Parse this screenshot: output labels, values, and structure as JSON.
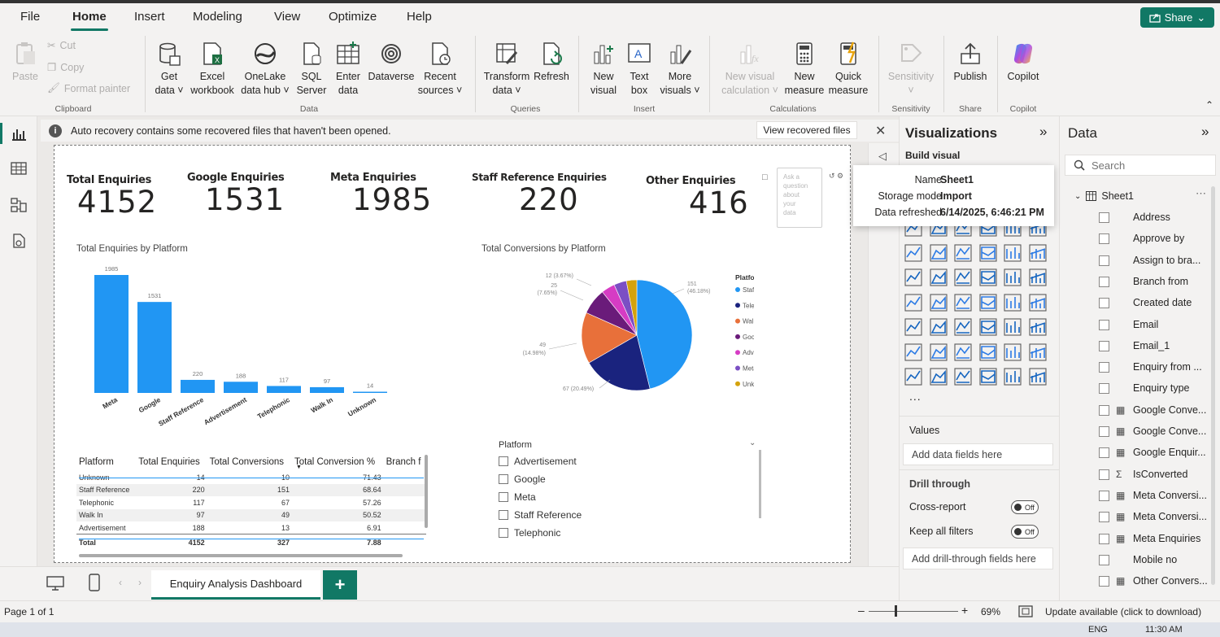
{
  "menu": [
    "File",
    "Home",
    "Insert",
    "Modeling",
    "View",
    "Optimize",
    "Help"
  ],
  "share_label": "Share",
  "ribbon": {
    "clipboard": {
      "paste": "Paste",
      "cut": "Cut",
      "copy": "Copy",
      "format_painter": "Format painter",
      "group": "Clipboard"
    },
    "data": {
      "buttons": [
        {
          "l1": "Get",
          "l2": "data"
        },
        {
          "l1": "Excel",
          "l2": "workbook"
        },
        {
          "l1": "OneLake",
          "l2": "data hub"
        },
        {
          "l1": "SQL",
          "l2": "Server"
        },
        {
          "l1": "Enter",
          "l2": "data"
        },
        {
          "l1": "Dataverse",
          "l2": ""
        },
        {
          "l1": "Recent",
          "l2": "sources"
        }
      ],
      "group": "Data"
    },
    "queries": {
      "transform_l1": "Transform",
      "transform_l2": "data",
      "refresh": "Refresh",
      "group": "Queries"
    },
    "insert": {
      "new_visual_l1": "New",
      "new_visual_l2": "visual",
      "text_box_l1": "Text",
      "text_box_l2": "box",
      "more_l1": "More",
      "more_l2": "visuals",
      "group": "Insert"
    },
    "calculations": {
      "nvc_l1": "New visual",
      "nvc_l2": "calculation",
      "nm_l1": "New",
      "nm_l2": "measure",
      "qm_l1": "Quick",
      "qm_l2": "measure",
      "group": "Calculations"
    },
    "sensitivity": {
      "label": "Sensitivity",
      "group": "Sensitivity"
    },
    "share": {
      "publish": "Publish",
      "group": "Share"
    },
    "copilot": {
      "label": "Copilot",
      "group": "Copilot"
    }
  },
  "notice": {
    "text": "Auto recovery contains some recovered files that haven't been opened.",
    "button": "View recovered files"
  },
  "kpis": [
    {
      "label": "Total Enquiries",
      "value": "4152"
    },
    {
      "label": "Google Enquiries",
      "value": "1531"
    },
    {
      "label": "Meta Enquiries",
      "value": "1985"
    },
    {
      "label": "Staff Reference Enquiries",
      "value": "220"
    },
    {
      "label": "Other Enquiries",
      "value": "416"
    }
  ],
  "qa_placeholder": [
    "Ask a",
    "question",
    "about",
    "your",
    "data"
  ],
  "chart_data": [
    {
      "type": "bar",
      "title": "Total Enquiries by Platform",
      "categories": [
        "Meta",
        "Google",
        "Staff Reference",
        "Advertisement",
        "Telephonic",
        "Walk In",
        "Unknown"
      ],
      "values": [
        1985,
        1531,
        220,
        188,
        117,
        97,
        14
      ],
      "color": "#2196f3"
    },
    {
      "type": "pie",
      "title": "Total Conversions by Platform",
      "legend_title": "Platform",
      "labels": [
        "Staff Reference",
        "Telephonic",
        "Walk In",
        "Google",
        "Advertisement",
        "Meta",
        "Unknown"
      ],
      "values": [
        151,
        67,
        49,
        25,
        13,
        12,
        10
      ],
      "colors": [
        "#2196f3",
        "#1a237e",
        "#e8703a",
        "#6a1b7a",
        "#d63cc4",
        "#7b4fc4",
        "#d4a20c"
      ],
      "data_labels": [
        {
          "l1": "151",
          "l2": "(46.18%)"
        },
        {
          "l1": "67 (20.49%)",
          "l2": ""
        },
        {
          "l1": "49",
          "l2": "(14.98%)"
        },
        {
          "l1": "25",
          "l2": "(7.65%)"
        },
        {
          "l1": "12 (3.67%)",
          "l2": ""
        }
      ]
    }
  ],
  "table": {
    "headers": [
      "Platform",
      "Total Enquiries",
      "Total Conversions",
      "Total Conversion %",
      "Branch f"
    ],
    "rows": [
      [
        "Unknown",
        "14",
        "10",
        "71.43"
      ],
      [
        "Staff Reference",
        "220",
        "151",
        "68.64"
      ],
      [
        "Telephonic",
        "117",
        "67",
        "57.26"
      ],
      [
        "Walk In",
        "97",
        "49",
        "50.52"
      ],
      [
        "Advertisement",
        "188",
        "13",
        "6.91"
      ]
    ],
    "total": [
      "Total",
      "4152",
      "327",
      "7.88"
    ]
  },
  "slicer": {
    "title": "Platform",
    "items": [
      "Advertisement",
      "Google",
      "Meta",
      "Staff Reference",
      "Telephonic"
    ]
  },
  "viz_pane": {
    "title": "Visualizations",
    "build_visual": "Build visual",
    "values_label": "Values",
    "values_drop": "Add data fields here",
    "drill_label": "Drill through",
    "cross_report": "Cross-report",
    "keep_filters": "Keep all filters",
    "toggle_off": "Off",
    "drill_drop": "Add drill-through fields here",
    "more": "..."
  },
  "tooltip": {
    "name_label": "Name",
    "name_value": "Sheet1",
    "mode_label": "Storage mode",
    "mode_value": "Import",
    "refreshed_label": "Data refreshed",
    "refreshed_value": "6/14/2025, 6:46:21 PM"
  },
  "data_pane": {
    "title": "Data",
    "search_placeholder": "Search",
    "table_name": "Sheet1",
    "fields": [
      {
        "name": "Address",
        "kind": "field"
      },
      {
        "name": "Approve by",
        "kind": "field"
      },
      {
        "name": "Assign to bra...",
        "kind": "field"
      },
      {
        "name": "Branch from",
        "kind": "field"
      },
      {
        "name": "Created date",
        "kind": "field"
      },
      {
        "name": "Email",
        "kind": "field"
      },
      {
        "name": "Email_1",
        "kind": "field"
      },
      {
        "name": "Enquiry from ...",
        "kind": "field"
      },
      {
        "name": "Enquiry type",
        "kind": "field"
      },
      {
        "name": "Google Conve...",
        "kind": "measure"
      },
      {
        "name": "Google Conve...",
        "kind": "measure"
      },
      {
        "name": "Google Enquir...",
        "kind": "measure"
      },
      {
        "name": "IsConverted",
        "kind": "sum"
      },
      {
        "name": "Meta Conversi...",
        "kind": "measure"
      },
      {
        "name": "Meta Conversi...",
        "kind": "measure"
      },
      {
        "name": "Meta Enquiries",
        "kind": "measure"
      },
      {
        "name": "Mobile no",
        "kind": "field"
      },
      {
        "name": "Other Convers...",
        "kind": "measure"
      }
    ]
  },
  "page_tab": "Enquiry Analysis Dashboard",
  "status": {
    "page": "Page 1 of 1",
    "zoom": "69%",
    "update": "Update available (click to download)"
  },
  "taskbar": {
    "lang": "ENG",
    "time": "11:30 AM"
  },
  "colors": {
    "accent": "#117865",
    "bar": "#2196f3"
  }
}
